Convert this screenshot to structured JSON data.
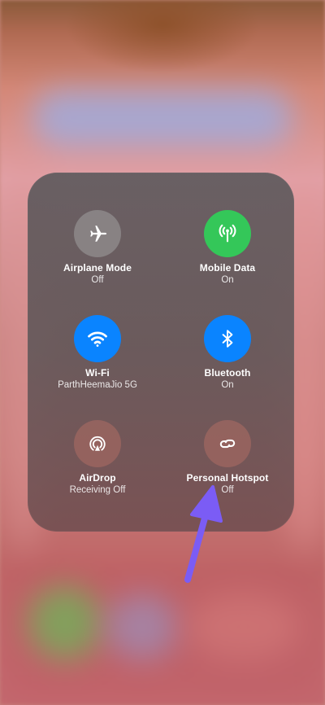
{
  "connectivity": {
    "airplane": {
      "label": "Airplane Mode",
      "status": "Off",
      "icon": "airplane-icon"
    },
    "mobile_data": {
      "label": "Mobile Data",
      "status": "On",
      "icon": "antenna-icon"
    },
    "wifi": {
      "label": "Wi-Fi",
      "status": "ParthHeemaJio 5G",
      "icon": "wifi-icon"
    },
    "bluetooth": {
      "label": "Bluetooth",
      "status": "On",
      "icon": "bluetooth-icon"
    },
    "airdrop": {
      "label": "AirDrop",
      "status": "Receiving Off",
      "icon": "airdrop-icon"
    },
    "hotspot": {
      "label": "Personal Hotspot",
      "status": "Off",
      "icon": "hotspot-link-icon"
    }
  },
  "colors": {
    "active_green": "#34c759",
    "active_blue": "#0a84ff",
    "arrow_purple": "#7b5cf5"
  }
}
